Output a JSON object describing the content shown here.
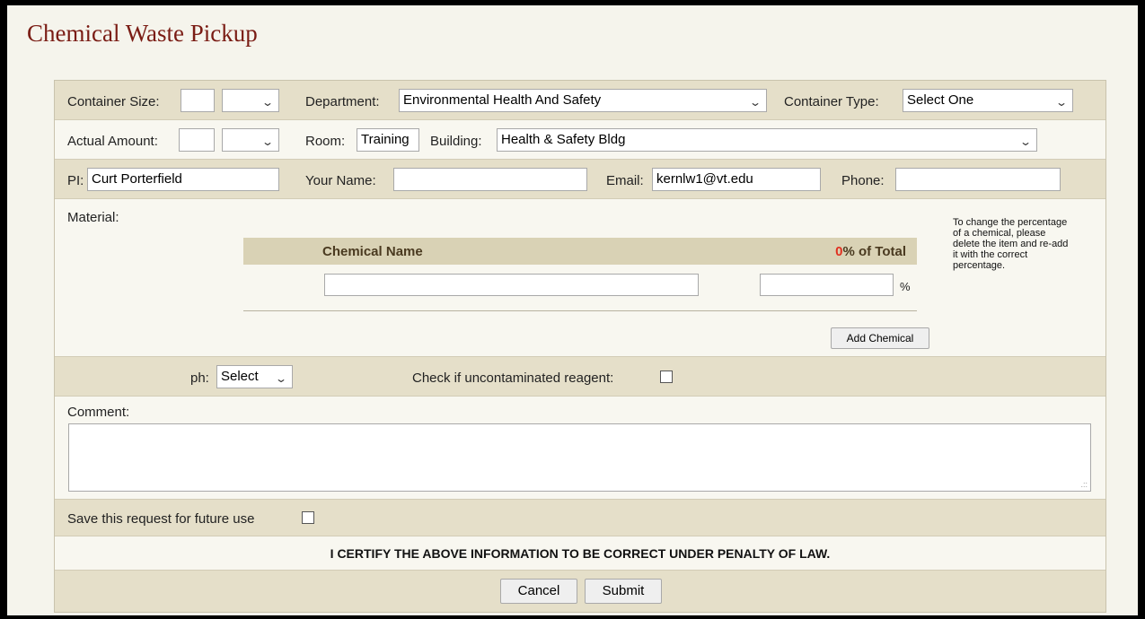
{
  "page": {
    "title": "Chemical Waste Pickup"
  },
  "row1": {
    "container_size_label": "Container Size:",
    "container_size_value": "",
    "container_size_unit": "",
    "department_label": "Department:",
    "department_value": "Environmental Health And Safety",
    "container_type_label": "Container Type:",
    "container_type_value": "Select One"
  },
  "row2": {
    "actual_amount_label": "Actual Amount:",
    "actual_amount_value": "",
    "actual_amount_unit": "",
    "room_label": "Room:",
    "room_value": "Training",
    "building_label": "Building:",
    "building_value": "Health & Safety Bldg"
  },
  "row3": {
    "pi_label": "PI:",
    "pi_value": "Curt Porterfield",
    "your_name_label": "Your Name:",
    "your_name_value": "",
    "email_label": "Email:",
    "email_value": "kernlw1@vt.edu",
    "phone_label": "Phone:",
    "phone_value": ""
  },
  "material": {
    "label": "Material:",
    "chemical_name_header": "Chemical Name",
    "percent_total_value": "0",
    "percent_total_suffix": "% of Total",
    "percent_sign": "%",
    "chemical_name_value": "",
    "percent_value": "",
    "add_button": "Add Chemical",
    "note": "To change the percentage of a chemical, please delete the item and re-add it with the correct percentage."
  },
  "ph_row": {
    "ph_label": "ph:",
    "ph_value": "Select",
    "reagent_label": "Check if uncontaminated reagent:"
  },
  "comment": {
    "label": "Comment:",
    "value": ""
  },
  "save": {
    "label": "Save this request for future use"
  },
  "certify": {
    "text": "I CERTIFY THE ABOVE INFORMATION TO BE CORRECT UNDER PENALTY OF LAW."
  },
  "actions": {
    "cancel": "Cancel",
    "submit": "Submit"
  },
  "colors": {
    "title": "#7a1c14",
    "accent_red": "#e03020",
    "tan": "#e5dfc9",
    "header_tan": "#d9d2b5"
  }
}
